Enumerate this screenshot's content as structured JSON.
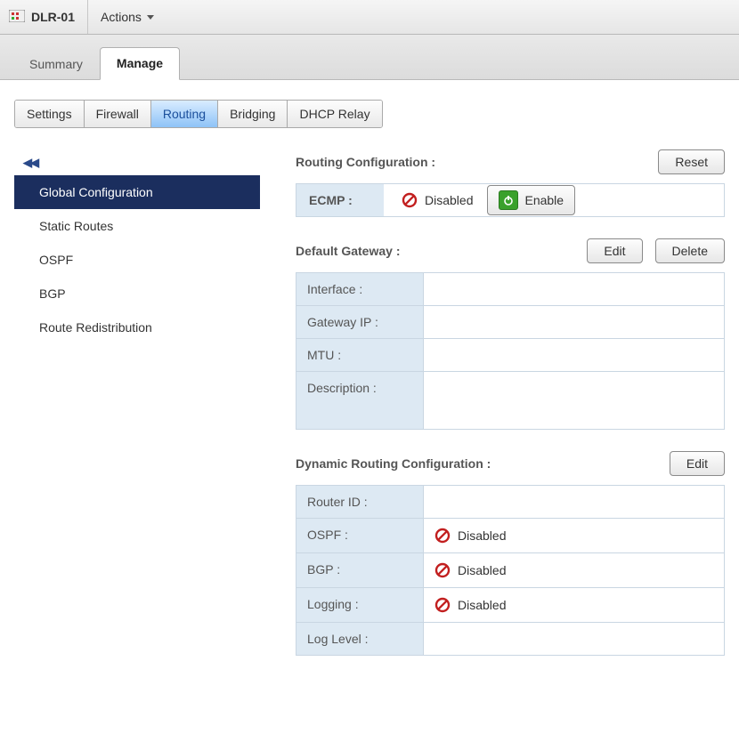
{
  "topbar": {
    "title": "DLR-01",
    "actions_label": "Actions"
  },
  "main_tabs": [
    {
      "label": "Summary",
      "active": false
    },
    {
      "label": "Manage",
      "active": true
    }
  ],
  "sub_tabs": [
    {
      "label": "Settings",
      "active": false
    },
    {
      "label": "Firewall",
      "active": false
    },
    {
      "label": "Routing",
      "active": true
    },
    {
      "label": "Bridging",
      "active": false
    },
    {
      "label": "DHCP Relay",
      "active": false
    }
  ],
  "sidebar": {
    "collapse_glyph": "◀◀",
    "items": [
      {
        "label": "Global Configuration",
        "active": true
      },
      {
        "label": "Static Routes"
      },
      {
        "label": "OSPF"
      },
      {
        "label": "BGP"
      },
      {
        "label": "Route Redistribution"
      }
    ]
  },
  "routing_config": {
    "title": "Routing Configuration :",
    "reset_label": "Reset",
    "ecmp_label": "ECMP :",
    "ecmp_status": "Disabled",
    "enable_label": "Enable"
  },
  "default_gateway": {
    "title": "Default Gateway :",
    "edit_label": "Edit",
    "delete_label": "Delete",
    "rows": [
      {
        "key": "Interface :",
        "val": ""
      },
      {
        "key": "Gateway IP :",
        "val": ""
      },
      {
        "key": "MTU :",
        "val": ""
      },
      {
        "key": "Description :",
        "val": ""
      }
    ]
  },
  "dynamic_routing": {
    "title": "Dynamic Routing Configuration :",
    "edit_label": "Edit",
    "rows": [
      {
        "key": "Router ID :",
        "val": "",
        "disabled_icon": false
      },
      {
        "key": "OSPF :",
        "val": "Disabled",
        "disabled_icon": true
      },
      {
        "key": "BGP :",
        "val": "Disabled",
        "disabled_icon": true
      },
      {
        "key": "Logging :",
        "val": "Disabled",
        "disabled_icon": true
      },
      {
        "key": "Log Level :",
        "val": "",
        "disabled_icon": false
      }
    ]
  }
}
